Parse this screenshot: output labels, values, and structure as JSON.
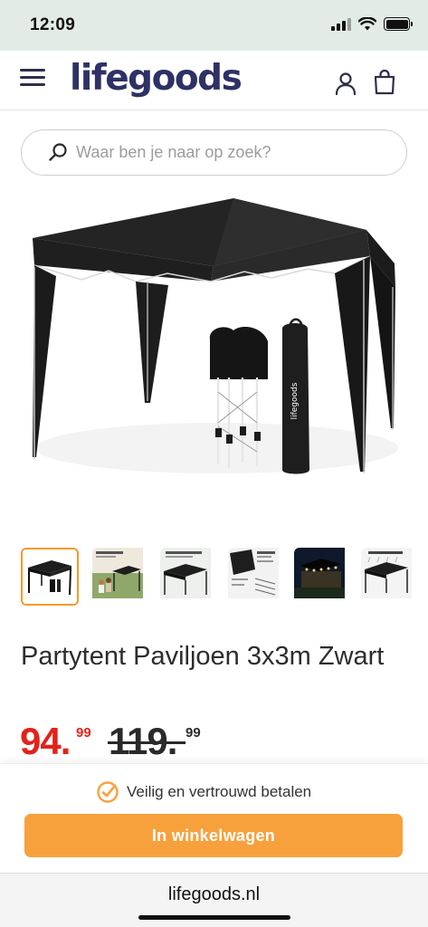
{
  "status_bar": {
    "time": "12:09"
  },
  "header": {
    "logo": "lifegoods",
    "menu_icon": "hamburger-menu-icon",
    "account_icon": "user-icon",
    "cart_icon": "shopping-bag-icon"
  },
  "search": {
    "placeholder": "Waar ben je naar op zoek?"
  },
  "product": {
    "title": "Partytent Paviljoen 3x3m Zwart",
    "price": {
      "current_whole": "94.",
      "current_cents": "99",
      "old_whole": "119.",
      "old_cents": "99"
    },
    "thumbnails": [
      {
        "name": "tent-front",
        "selected": true
      },
      {
        "name": "tent-features",
        "selected": false
      },
      {
        "name": "tent-height-adjustable",
        "selected": false
      },
      {
        "name": "tent-contents",
        "selected": false
      },
      {
        "name": "tent-night",
        "selected": false
      },
      {
        "name": "tent-weatherproof",
        "selected": false
      }
    ]
  },
  "sticky_bar": {
    "trust_text": "Veilig en vertrouwd betalen",
    "cta_label": "In winkelwagen"
  },
  "browser": {
    "url": "lifegoods.nl"
  },
  "colors": {
    "brand": "#2e3166",
    "accent": "#f7a13d",
    "price": "#e2231a",
    "status_bar_bg": "#e3ebe6"
  }
}
